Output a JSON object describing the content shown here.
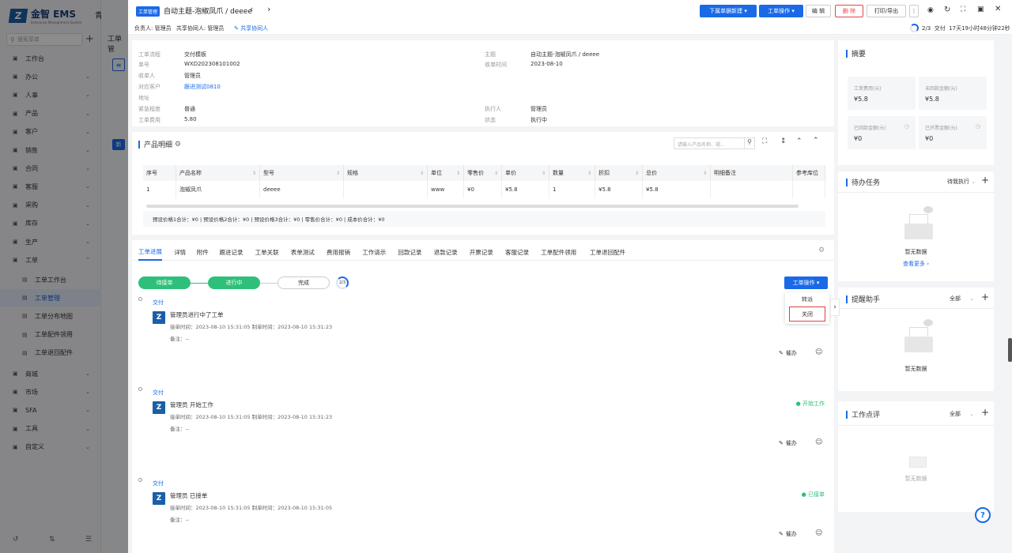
{
  "app": {
    "brand": "金智 EMS",
    "brand_sub": "Enterprise Management System",
    "company": "青岛金智"
  },
  "sidebar": {
    "search_placeholder": "搜索菜单",
    "items": [
      {
        "label": "工作台",
        "icon": "grid-icon",
        "chev": false
      },
      {
        "label": "办公",
        "icon": "office-icon",
        "chev": true
      },
      {
        "label": "人事",
        "icon": "person-icon",
        "chev": true
      },
      {
        "label": "产品",
        "icon": "box-icon",
        "chev": true
      },
      {
        "label": "客户",
        "icon": "customer-icon",
        "chev": true
      },
      {
        "label": "销售",
        "icon": "sales-icon",
        "chev": true
      },
      {
        "label": "合同",
        "icon": "contract-icon",
        "chev": true
      },
      {
        "label": "客服",
        "icon": "service-icon",
        "chev": true
      },
      {
        "label": "采购",
        "icon": "purchase-icon",
        "chev": true
      },
      {
        "label": "库存",
        "icon": "stock-icon",
        "chev": true
      },
      {
        "label": "生产",
        "icon": "factory-icon",
        "chev": true
      },
      {
        "label": "工单",
        "icon": "workorder-icon",
        "chev": true
      }
    ],
    "subitems": [
      "工单工作台",
      "工单管理",
      "工单分布地图",
      "工单配件领用",
      "工单退回配件"
    ],
    "items2": [
      {
        "label": "商城",
        "icon": "shop-icon"
      },
      {
        "label": "市场",
        "icon": "market-icon"
      },
      {
        "label": "SFA",
        "icon": "sfa-icon"
      },
      {
        "label": "工具",
        "icon": "tool-icon"
      },
      {
        "label": "自定义",
        "icon": "custom-icon"
      }
    ],
    "behind_title": "工单管",
    "behind_btn": "新"
  },
  "header": {
    "tag": "工单管理",
    "title": "自动主题-泡椒凤爪 / deeee",
    "owner_label": "负责人:",
    "owner": "管理员",
    "share_label": "共享协同人:",
    "share": "管理员",
    "share_link": "共享协同人",
    "btn_next": "下属单据新建",
    "btn_op": "工单操作",
    "btn_edit": "编 辑",
    "btn_delete": "删 除",
    "btn_print": "打印/导出",
    "progress_text": "2/3",
    "progress_stage": "交付",
    "timer": "17天19小时48分钟22秒"
  },
  "info": {
    "left": [
      {
        "k": "工单流程",
        "v": "交付模板",
        "link": false
      },
      {
        "k": "单号",
        "v": "WXD202308101002",
        "link": false
      },
      {
        "k": "收单人",
        "v": "管理员",
        "link": false
      },
      {
        "k": "对应客户",
        "v": "跟进测试0810",
        "link": true
      },
      {
        "k": "地址",
        "v": "",
        "link": false
      },
      {
        "k": "紧急程度",
        "v": "普通",
        "link": false
      },
      {
        "k": "工单费用",
        "v": "5.80",
        "link": false
      }
    ],
    "right": [
      {
        "k": "主题",
        "v": "自动主题-泡椒凤爪 / deeee"
      },
      {
        "k": "收单时间",
        "v": "2023-08-10"
      },
      {
        "k": "执行人",
        "v": "管理员"
      },
      {
        "k": "状态",
        "v": "执行中"
      }
    ]
  },
  "products": {
    "title": "产品明细",
    "search_placeholder": "请输入产品名称、规...",
    "columns": [
      "序号",
      "产品名称",
      "型号",
      "规格",
      "单位",
      "零售价",
      "单价",
      "数量",
      "折扣",
      "总价",
      "明细备注",
      "参考库位"
    ],
    "row": [
      "1",
      "泡椒凤爪",
      "deeee",
      "",
      "www",
      "¥0",
      "¥5.8",
      "1",
      "¥5.8",
      "¥5.8",
      "",
      ""
    ],
    "summary": "预设价格1合计：¥0 |   预设价格2合计：¥0 |   预设价格3合计：¥0 |   零售价合计：¥0 |   成本价合计：¥0"
  },
  "tabs": [
    "工单进展",
    "详情",
    "附件",
    "跟进记录",
    "工单关联",
    "表单测试",
    "费用报销",
    "工作请示",
    "回款记录",
    "退款记录",
    "开票记录",
    "客服记录",
    "工单配件领用",
    "工单退回配件"
  ],
  "flow": {
    "s1": "待接单",
    "s2": "进行中",
    "s3": "完成",
    "ring": "2/3",
    "op_btn": "工单操作",
    "menu": [
      "转派",
      "关闭"
    ]
  },
  "timeline": [
    {
      "stage": "交付",
      "title": "管理员进行中了工单",
      "times": "接单时间：2023-08-10 15:31:05   制单时间：2023-08-10 15:31:23",
      "note": "备注：--",
      "badge": ""
    },
    {
      "stage": "交付",
      "title": "管理员 开始工作",
      "times": "接单时间：2023-08-10 15:31:05   制单时间：2023-08-10 15:31:23",
      "note": "备注：--",
      "badge": "● 开始工作"
    },
    {
      "stage": "交付",
      "title": "管理员 已接单",
      "times": "接单时间：2023-08-10 15:31:05   制单时间：2023-08-10 15:31:05",
      "note": "备注：--",
      "badge": "● 已接单"
    }
  ],
  "timeline_action": "催办",
  "summary": {
    "title": "摘要",
    "stats": [
      {
        "k": "工单费用(元)",
        "v": "¥5.8"
      },
      {
        "k": "未回款金额(元)",
        "v": "¥5.8"
      },
      {
        "k": "已回款金额(元)",
        "v": "¥0"
      },
      {
        "k": "已开票金额(元)",
        "v": "¥0"
      }
    ]
  },
  "todo": {
    "title": "待办任务",
    "filter": "待我执行",
    "empty": "暂无数据",
    "more": "查看更多"
  },
  "reminder": {
    "title": "提醒助手",
    "filter": "全部",
    "empty": "暂无数据"
  },
  "review": {
    "title": "工作点评",
    "filter": "全部",
    "empty": "暂无数据"
  },
  "colors": {
    "primary": "#1a6ae8",
    "green": "#2ec07a",
    "red": "#e54545"
  }
}
